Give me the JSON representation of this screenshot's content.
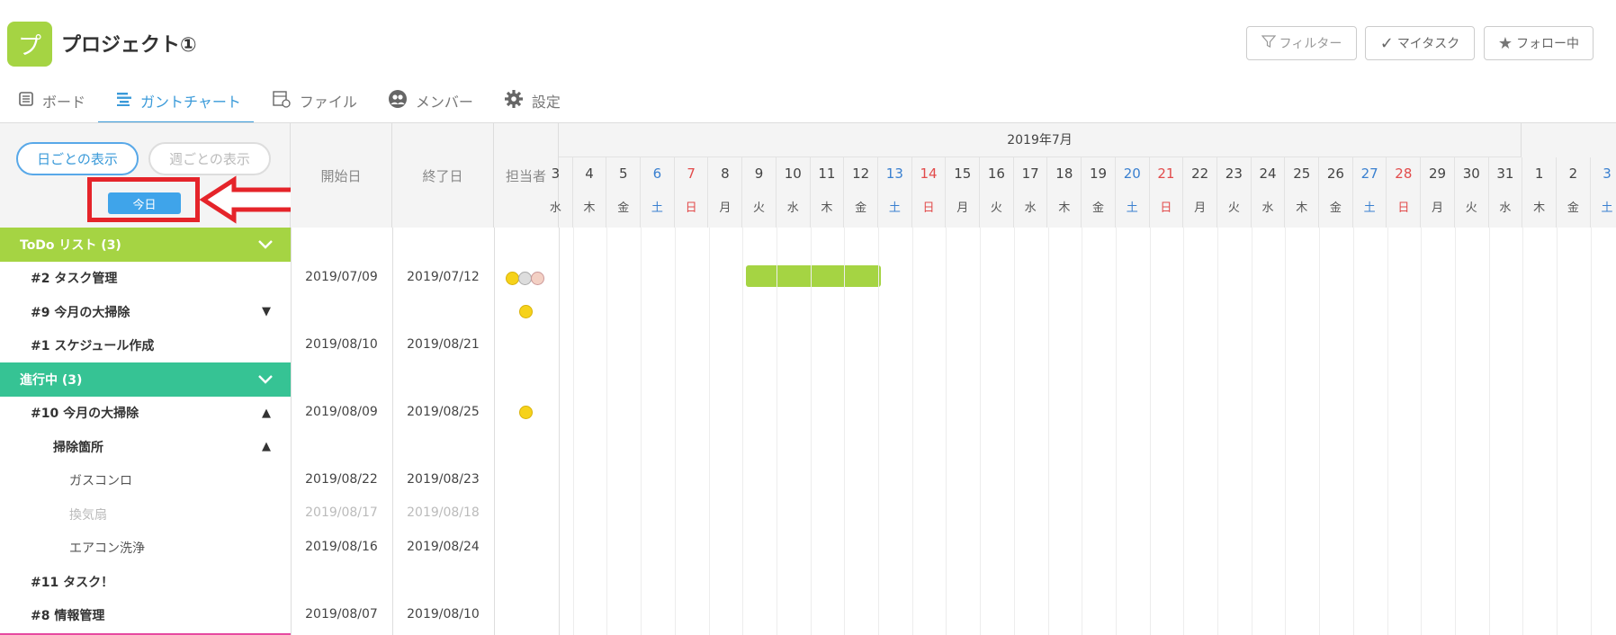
{
  "header": {
    "logo_char": "プ",
    "project_title": "プロジェクト①",
    "buttons": {
      "filter": "フィルター",
      "mytask": "マイタスク",
      "follow": "フォロー中"
    }
  },
  "tabs": [
    "ボード",
    "ガントチャート",
    "ファイル",
    "メンバー",
    "設定"
  ],
  "gantt": {
    "view_daily": "日ごとの表示",
    "view_weekly": "週ごとの表示",
    "today": "今日",
    "col_start": "開始日",
    "col_end": "終了日",
    "col_assignee": "担当者",
    "month": "2019年7月",
    "days": [
      {
        "n": "3",
        "w": "水"
      },
      {
        "n": "4",
        "w": "木"
      },
      {
        "n": "5",
        "w": "金"
      },
      {
        "n": "6",
        "w": "土"
      },
      {
        "n": "7",
        "w": "日"
      },
      {
        "n": "8",
        "w": "月"
      },
      {
        "n": "9",
        "w": "火"
      },
      {
        "n": "10",
        "w": "水"
      },
      {
        "n": "11",
        "w": "木"
      },
      {
        "n": "12",
        "w": "金"
      },
      {
        "n": "13",
        "w": "土"
      },
      {
        "n": "14",
        "w": "日"
      },
      {
        "n": "15",
        "w": "月"
      },
      {
        "n": "16",
        "w": "火"
      },
      {
        "n": "17",
        "w": "水"
      },
      {
        "n": "18",
        "w": "木"
      },
      {
        "n": "19",
        "w": "金"
      },
      {
        "n": "20",
        "w": "土"
      },
      {
        "n": "21",
        "w": "日"
      },
      {
        "n": "22",
        "w": "月"
      },
      {
        "n": "23",
        "w": "火"
      },
      {
        "n": "24",
        "w": "水"
      },
      {
        "n": "25",
        "w": "木"
      },
      {
        "n": "26",
        "w": "金"
      },
      {
        "n": "27",
        "w": "土"
      },
      {
        "n": "28",
        "w": "日"
      },
      {
        "n": "29",
        "w": "月"
      },
      {
        "n": "30",
        "w": "火"
      },
      {
        "n": "31",
        "w": "水"
      },
      {
        "n": "1",
        "w": "木"
      },
      {
        "n": "2",
        "w": "金"
      },
      {
        "n": "3",
        "w": "土"
      }
    ],
    "groups": {
      "todo": "ToDo リスト (3)",
      "progress": "進行中 (3)"
    },
    "rows": {
      "r1": {
        "label": "#2 タスク管理",
        "start": "2019/07/09",
        "end": "2019/07/12"
      },
      "r2": {
        "label": "#9 今月の大掃除"
      },
      "r3": {
        "label": "#1 スケジュール作成",
        "start": "2019/08/10",
        "end": "2019/08/21"
      },
      "r4": {
        "label": "#10 今月の大掃除",
        "start": "2019/08/09",
        "end": "2019/08/25"
      },
      "r5": {
        "label": "掃除箇所"
      },
      "r6": {
        "label": "ガスコンロ",
        "start": "2019/08/22",
        "end": "2019/08/23"
      },
      "r7": {
        "label": "換気扇",
        "start": "2019/08/17",
        "end": "2019/08/18"
      },
      "r8": {
        "label": "エアコン洗浄",
        "start": "2019/08/16",
        "end": "2019/08/24"
      },
      "r9": {
        "label": "#11 タスク！"
      },
      "r10": {
        "label": "#8 情報管理",
        "start": "2019/08/07",
        "end": "2019/08/10"
      }
    }
  }
}
